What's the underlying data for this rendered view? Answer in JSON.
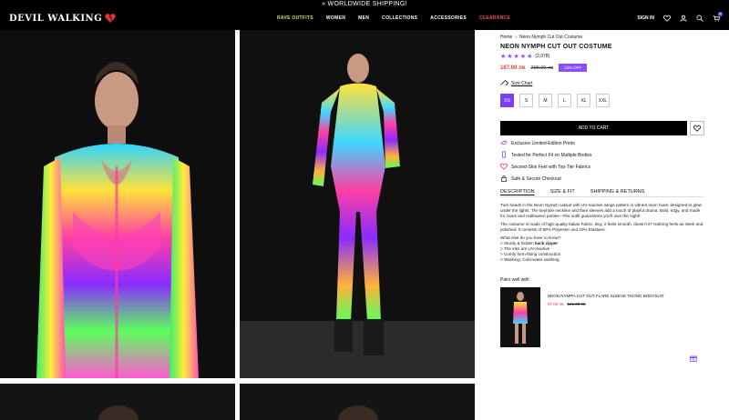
{
  "announcement": "» WORLDWIDE SHIPPING!",
  "brand": {
    "logo_text": "DEVIL WALKING",
    "heart_icon": "broken-heart-icon"
  },
  "nav": {
    "items": [
      "RAVE OUTFITS",
      "WOMEN",
      "MEN",
      "COLLECTIONS",
      "ACCESSORIES",
      "CLEARANCE"
    ],
    "right_label": "SIGN IN",
    "cart_count": "0",
    "colors": {
      "rave": "#c8e64b",
      "clearance": "#ff4d4d"
    }
  },
  "breadcrumb": {
    "home": "Home",
    "sep": "›",
    "current": "Neon Nymph Cut Out Costume"
  },
  "product": {
    "title": "NEON NYMPH CUT OUT COSTUME",
    "stars": "★★★★★",
    "review_count": "(2,078)",
    "price": "167.00 лв",
    "old_price": "209.00 лв",
    "discount": "15% OFF",
    "size_chart": "Size Chart",
    "sizes": [
      "XS",
      "S",
      "M",
      "L",
      "XL",
      "XXL"
    ],
    "selected_size": "XS",
    "add_to_cart": "ADD TO CART",
    "accent": "#8a4dff"
  },
  "features": [
    {
      "icon": "star-badge-icon",
      "text": "Exclusive Limited-Edition Prints"
    },
    {
      "icon": "ruler-icon",
      "text": "Tested for Perfect Fit on Multiple Bodies"
    },
    {
      "icon": "heart-outline-icon",
      "text": "Second-Skin Feel with Top-Tier Fabrics"
    },
    {
      "icon": "lock-icon",
      "text": "Safe & Secure Checkout"
    }
  ],
  "tabs": [
    "DESCRIPTION",
    "SIZE & FIT",
    "SHIPPING & RETURNS"
  ],
  "description": {
    "p1": "Turn heads in the Neon Nymph catsuit with UV-reactive wings pattern in vibrant neon hues, designed to glow under the lights. The keyhole neckline and flare sleeves add a touch of playful drama. Bold, edgy, and made for raves and Halloween parties—this outfit guarantees you'll own the night!",
    "p2": "The costume is made of high-quality Italian Fabric. Boy, it feels smooth, doesn't it? Nothing feels as sleek and polished. It consists of 80% Polyester and 20% Elastane.",
    "q": "What else do you have to know?",
    "b1_pre": "> Sturdy & hidden ",
    "b1_bold": "back zipper",
    "b2": "> The inks are UV-reactive",
    "b3": "> Comfy form-fitting construction",
    "b4": "> Washing: Cold-water washing"
  },
  "pairs": {
    "heading": "Pairs well with",
    "name": "NEON NYMPH CUT OUT FLARE SLEEVE THONG BODYSUIT",
    "price": "97.00 лв",
    "old_price": "121.00 лв"
  }
}
